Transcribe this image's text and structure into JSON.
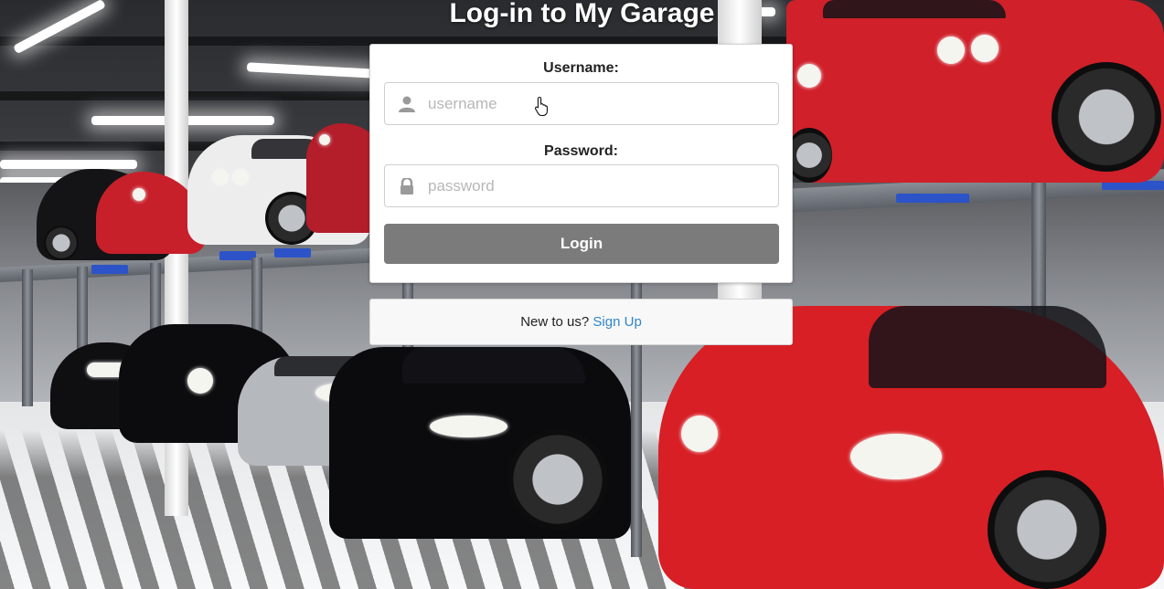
{
  "page_title": "Log-in to My Garage",
  "login_form": {
    "username_label": "Username:",
    "username_placeholder": "username",
    "username_value": "",
    "username_icon": "user-icon",
    "password_label": "Password:",
    "password_placeholder": "password",
    "password_value": "",
    "password_icon": "lock-icon",
    "login_button_label": "Login"
  },
  "signup": {
    "prompt": "New to us?",
    "link_label": "Sign Up"
  },
  "colors": {
    "login_button": "#7b7b7b",
    "link": "#2f86c8",
    "title_text": "#ffffff"
  }
}
